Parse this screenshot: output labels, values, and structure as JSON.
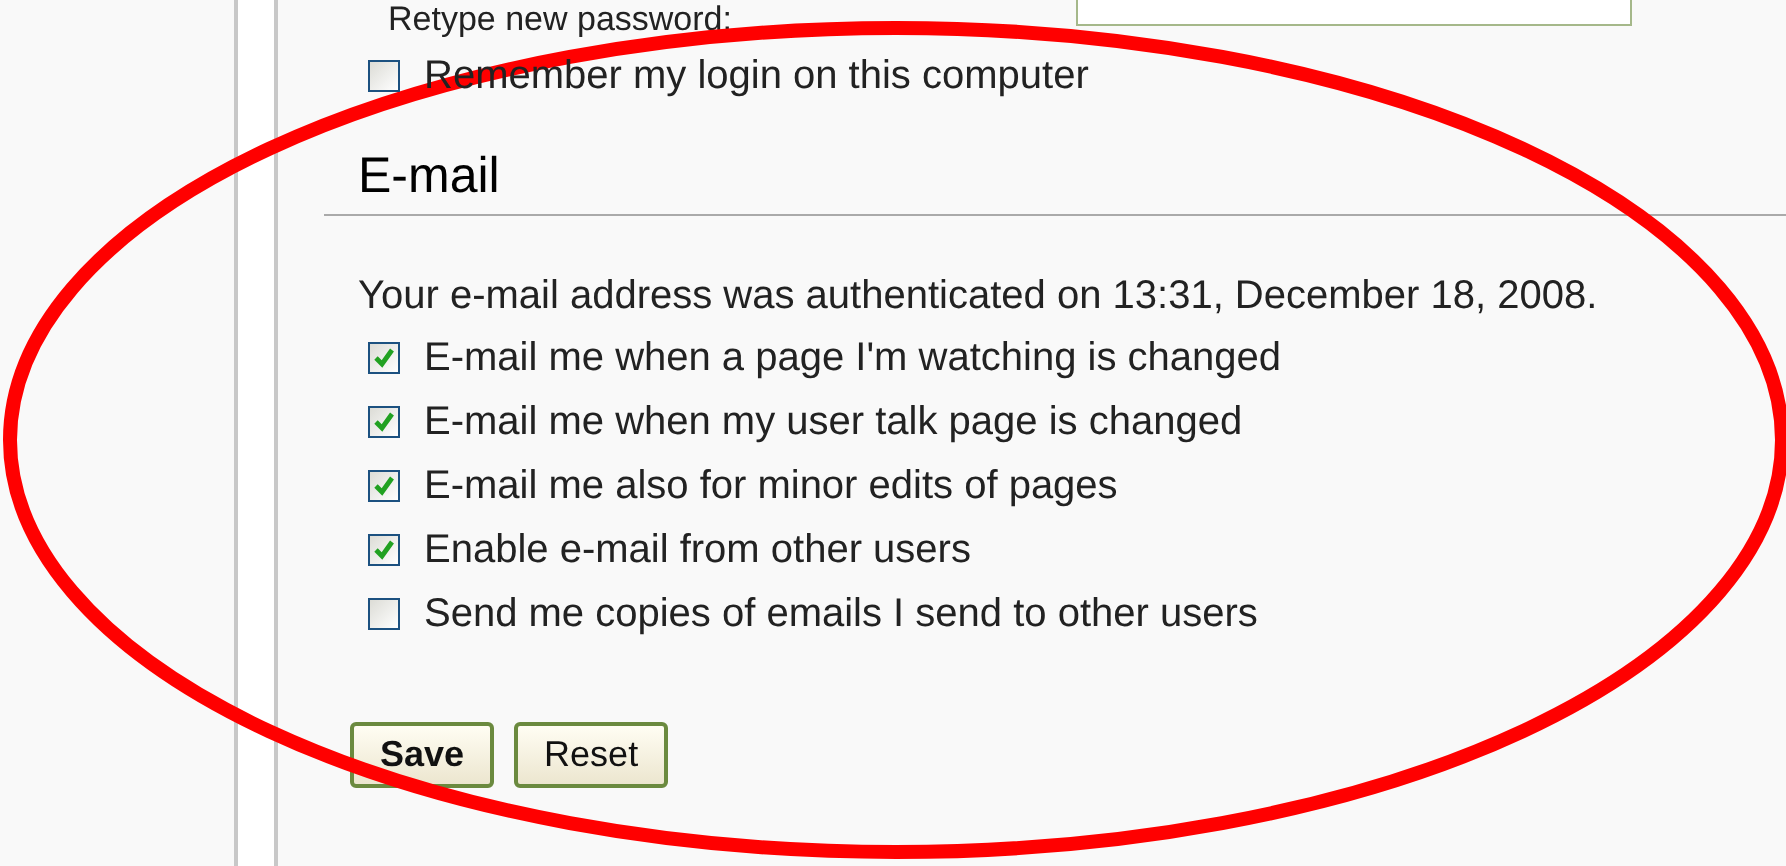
{
  "password": {
    "label": "Retype new password:"
  },
  "remember": {
    "label": "Remember my login on this computer",
    "checked": false
  },
  "email_section": {
    "heading": "E-mail",
    "status": "Your e-mail address was authenticated on 13:31, December 18, 2008.",
    "options": [
      {
        "label": "E-mail me when a page I'm watching is changed",
        "checked": true
      },
      {
        "label": "E-mail me when my user talk page is changed",
        "checked": true
      },
      {
        "label": "E-mail me also for minor edits of pages",
        "checked": true
      },
      {
        "label": "Enable e-mail from other users",
        "checked": true
      },
      {
        "label": "Send me copies of emails I send to other users",
        "checked": false
      }
    ]
  },
  "buttons": [
    {
      "label": "Save",
      "kind": "primary"
    },
    {
      "label": "Reset",
      "kind": "secondary"
    }
  ],
  "annotations": [
    {
      "kind": "ellipse"
    }
  ]
}
